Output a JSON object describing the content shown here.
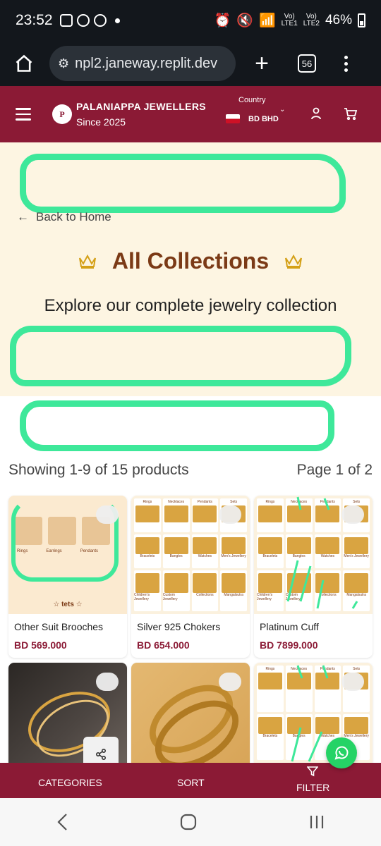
{
  "status_bar": {
    "time": "23:52",
    "battery": "46%",
    "sim1": "LTE1",
    "sim2": "LTE2",
    "vo": "Vo)"
  },
  "browser": {
    "url": "npl2.janeway.replit.dev",
    "tab_count": "56"
  },
  "header": {
    "brand_name": "PALANIAPPA JEWELLERS",
    "brand_since": "Since 2025",
    "logo_letter": "P",
    "country_label": "Country",
    "country_value": "BD BHD"
  },
  "hero": {
    "back_label": "Back to Home",
    "title": "All Collections",
    "subtitle": "Explore our complete jewelry collection"
  },
  "results": {
    "showing": "Showing 1-9 of 15 products",
    "page": "Page 1 of 2"
  },
  "products": [
    {
      "name": "Other Suit Brooches",
      "price": "BD 569.000",
      "tag": "tets"
    },
    {
      "name": "Silver 925 Chokers",
      "price": "BD 654.000"
    },
    {
      "name": "Platinum Cuff",
      "price": "BD 7899.000"
    }
  ],
  "card1_labels": [
    "Rings",
    "Earrings",
    "Pendants"
  ],
  "mosaic_labels": [
    "Rings",
    "Necklaces",
    "Pendants",
    "Sets",
    "Bracelets",
    "Bangles",
    "Watches",
    "Men's Jewellery",
    "Children's Jewellery",
    "Custom Jewellery",
    "Collections",
    "Mangalsutra"
  ],
  "toolbar": {
    "categories": "CATEGORIES",
    "sort": "SORT",
    "filter": "FILTER"
  },
  "colors": {
    "maroon": "#8b1a35",
    "brown": "#7b3a16",
    "cream": "#fdf5e2",
    "scribble": "#3ee89a"
  }
}
